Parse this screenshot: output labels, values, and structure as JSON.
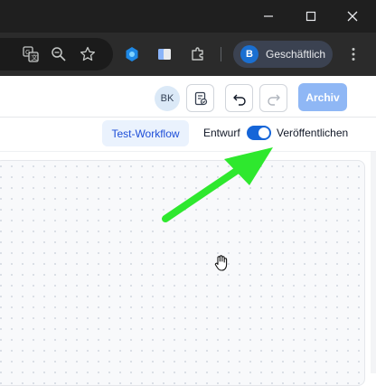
{
  "browser": {
    "window_controls": [
      "minimize-icon",
      "maximize-icon",
      "close-icon"
    ],
    "toolbar_icons": [
      "translate-icon",
      "zoom-icon",
      "star-icon",
      "extension-colored-icon",
      "docs-extension-icon",
      "puzzle-icon",
      "more-vert-icon"
    ],
    "profile": {
      "initial": "B",
      "label": "Geschäftlich"
    }
  },
  "header": {
    "user_initials": "BK",
    "archive_label": "Archiv"
  },
  "toolbar": {
    "workflow_tab": "Test-Workflow",
    "draft_label": "Entwurf",
    "publish_label": "Veröffentlichen",
    "publish_toggle_on": true
  },
  "colors": {
    "accent": "#1565d8",
    "arrow": "#2ee82e",
    "archive_button": "#8fb7f5"
  }
}
